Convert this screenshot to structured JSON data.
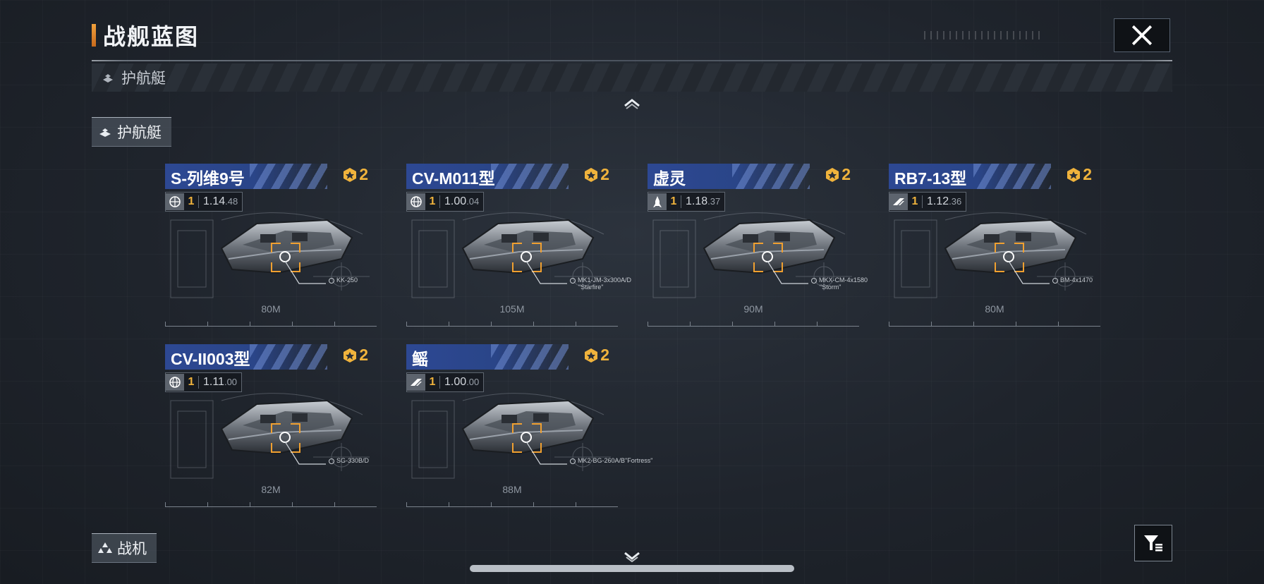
{
  "page": {
    "title": "战舰蓝图",
    "close_icon": "close-icon"
  },
  "category_bar": {
    "label": "护航艇",
    "icon": "stack-icon"
  },
  "sections": [
    {
      "label": "护航艇",
      "icon": "stack-icon"
    },
    {
      "label": "战机",
      "icon": "triple-triangle-icon"
    }
  ],
  "colors": {
    "accent": "#f0b33c",
    "name_bar": "#2d4893",
    "panel": "#23282f"
  },
  "ships": [
    {
      "name": "S-列维9号",
      "rank": "2",
      "level": "1",
      "power": "1.14",
      "power_frac": ".48",
      "type_icon": "gear-globe-icon",
      "length": "80M",
      "callout": "KK-250"
    },
    {
      "name": "CV-M011型",
      "rank": "2",
      "level": "1",
      "power": "1.00",
      "power_frac": ".04",
      "type_icon": "globe-icon",
      "length": "105M",
      "callout": "MK1-JM-3x300A/D",
      "callout2": "\"Starfire\""
    },
    {
      "name": "虚灵",
      "rank": "2",
      "level": "1",
      "power": "1.18",
      "power_frac": ".37",
      "type_icon": "rocket-icon",
      "length": "90M",
      "callout": "MKX-CM-4x1580",
      "callout2": "\"Storm\""
    },
    {
      "name": "RB7-13型",
      "rank": "2",
      "level": "1",
      "power": "1.12",
      "power_frac": ".36",
      "type_icon": "faction-wing-icon",
      "length": "80M",
      "callout": "BM-4x1470"
    },
    {
      "name": "CV-II003型",
      "rank": "2",
      "level": "1",
      "power": "1.11",
      "power_frac": ".00",
      "type_icon": "globe-icon",
      "length": "82M",
      "callout": "SG-330B/D"
    },
    {
      "name": "鳐",
      "rank": "2",
      "level": "1",
      "power": "1.00",
      "power_frac": ".00",
      "type_icon": "faction-wing-icon",
      "length": "88M",
      "callout": "MK2-BG-260A/B\"Fortress\""
    }
  ],
  "controls": {
    "filter_icon": "filter-icon",
    "scroll_up_icon": "chevron-up-icon",
    "scroll_down_icon": "chevron-down-icon"
  }
}
